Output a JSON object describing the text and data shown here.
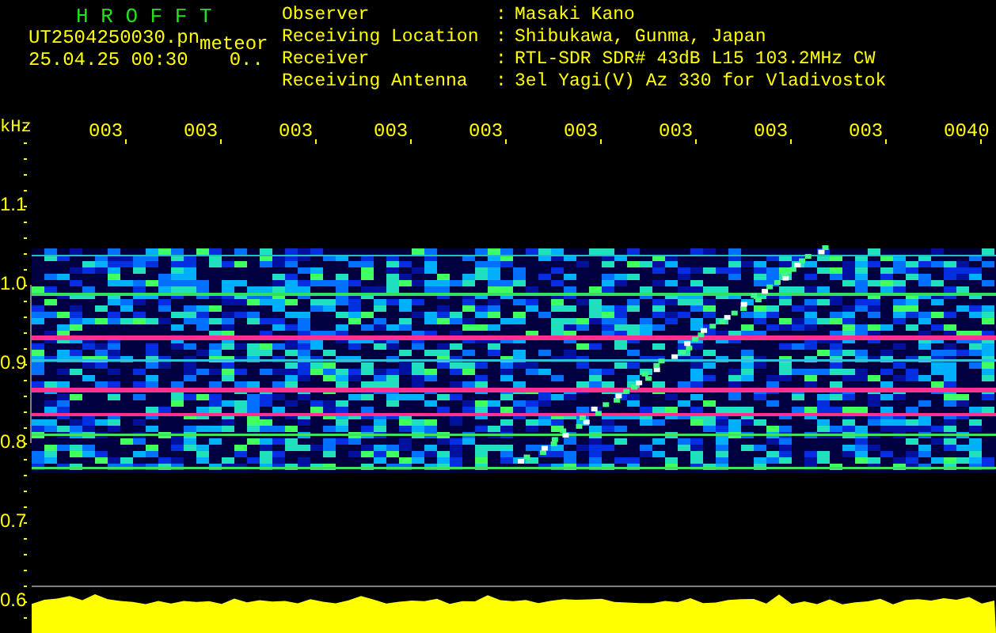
{
  "header": {
    "title": "H R O F F T",
    "file_name": "UT2504250030.pn",
    "tag": "meteor",
    "timestamp": "25.04.25 00:30",
    "counter": "0.."
  },
  "info": [
    {
      "label": "Observer",
      "separator": ":",
      "value": "Masaki Kano"
    },
    {
      "label": "Receiving Location",
      "separator": ":",
      "value": "Shibukawa, Gunma, Japan"
    },
    {
      "label": "Receiver",
      "separator": ":",
      "value": "RTL-SDR SDR# 43dB L15 103.2MHz CW"
    },
    {
      "label": "Receiving Antenna",
      "separator": ":",
      "value": "3el Yagi(V) Az 330 for Vladivostok"
    }
  ],
  "axis": {
    "unit": "kHz",
    "x_labels": [
      "003",
      "003",
      "003",
      "003",
      "003",
      "003",
      "003",
      "003",
      "003",
      "0040"
    ],
    "y_labels": [
      "1.1",
      "1.0",
      "0.9",
      "0.8",
      "0.7",
      "0.6"
    ]
  }
}
